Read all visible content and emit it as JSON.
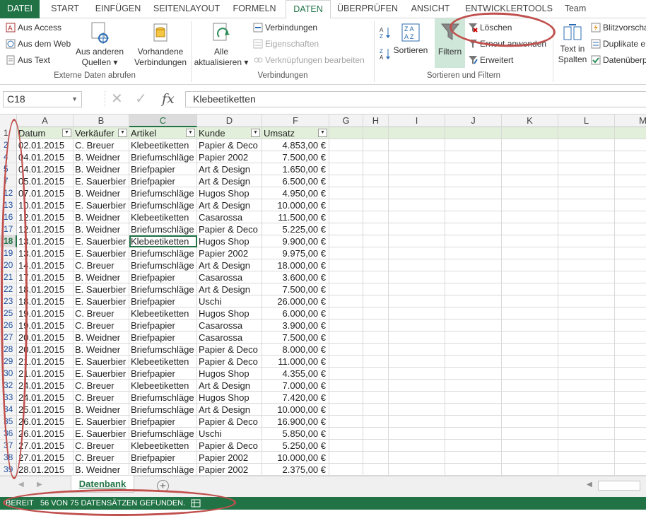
{
  "tabs": {
    "file": "DATEI",
    "start": "START",
    "insert": "EINFÜGEN",
    "pagelayout": "SEITENLAYOUT",
    "formulas": "FORMELN",
    "data": "DATEN",
    "review": "ÜBERPRÜFEN",
    "view": "ANSICHT",
    "developer": "ENTWICKLERTOOLS",
    "team": "Team"
  },
  "ribbon": {
    "ext_data": {
      "from_access": "Aus Access",
      "from_web": "Aus dem Web",
      "from_text": "Aus Text",
      "other_sources_1": "Aus anderen",
      "other_sources_2": "Quellen",
      "existing_conn_1": "Vorhandene",
      "existing_conn_2": "Verbindungen",
      "label": "Externe Daten abrufen"
    },
    "connections": {
      "refresh_1": "Alle",
      "refresh_2": "aktualisieren",
      "connections": "Verbindungen",
      "properties": "Eigenschaften",
      "edit_links": "Verknüpfungen bearbeiten",
      "label": "Verbindungen"
    },
    "sort_filter": {
      "sort": "Sortieren",
      "filter": "Filtern",
      "clear": "Löschen",
      "reapply": "Erneut anwenden",
      "advanced": "Erweitert",
      "label": "Sortieren und Filtern"
    },
    "data_tools": {
      "text_cols_1": "Text in",
      "text_cols_2": "Spalten",
      "flash_fill": "Blitzvorscha",
      "remove_dup": "Duplikate e",
      "validation": "Datenüberp"
    }
  },
  "formula_bar": {
    "name_box": "C18",
    "fx": "fx",
    "value": "Klebeetiketten"
  },
  "columns": [
    "A",
    "B",
    "C",
    "D",
    "F",
    "G",
    "H",
    "I",
    "J",
    "K",
    "L",
    "M"
  ],
  "header_row": {
    "num": "1",
    "cells": [
      "Datum",
      "Verkäufer",
      "Artikel",
      "Kunde",
      "Umsatz"
    ]
  },
  "rows": [
    {
      "num": "2",
      "cells": [
        "02.01.2015",
        "C. Breuer",
        "Klebeetiketten",
        "Papier & Deco",
        "4.853,00 €"
      ]
    },
    {
      "num": "4",
      "cells": [
        "04.01.2015",
        "B. Weidner",
        "Briefumschläge",
        "Papier 2002",
        "7.500,00 €"
      ]
    },
    {
      "num": "5",
      "cells": [
        "04.01.2015",
        "B. Weidner",
        "Briefpapier",
        "Art & Design",
        "1.650,00 €"
      ]
    },
    {
      "num": "7",
      "cells": [
        "05.01.2015",
        "E. Sauerbier",
        "Briefpapier",
        "Art & Design",
        "6.500,00 €"
      ]
    },
    {
      "num": "12",
      "cells": [
        "07.01.2015",
        "B. Weidner",
        "Briefumschläge",
        "Hugos Shop",
        "4.950,00 €"
      ]
    },
    {
      "num": "13",
      "cells": [
        "10.01.2015",
        "E. Sauerbier",
        "Briefumschläge",
        "Art & Design",
        "10.000,00 €"
      ]
    },
    {
      "num": "16",
      "cells": [
        "12.01.2015",
        "B. Weidner",
        "Klebeetiketten",
        "Casarossa",
        "11.500,00 €"
      ]
    },
    {
      "num": "17",
      "cells": [
        "12.01.2015",
        "B. Weidner",
        "Briefumschläge",
        "Papier & Deco",
        "5.225,00 €"
      ]
    },
    {
      "num": "18",
      "cells": [
        "13.01.2015",
        "E. Sauerbier",
        "Klebeetiketten",
        "Hugos Shop",
        "9.900,00 €"
      ]
    },
    {
      "num": "19",
      "cells": [
        "13.01.2015",
        "E. Sauerbier",
        "Briefumschläge",
        "Papier 2002",
        "9.975,00 €"
      ]
    },
    {
      "num": "20",
      "cells": [
        "14.01.2015",
        "C. Breuer",
        "Briefumschläge",
        "Art & Design",
        "18.000,00 €"
      ]
    },
    {
      "num": "21",
      "cells": [
        "17.01.2015",
        "B. Weidner",
        "Briefpapier",
        "Casarossa",
        "3.600,00 €"
      ]
    },
    {
      "num": "22",
      "cells": [
        "18.01.2015",
        "E. Sauerbier",
        "Briefumschläge",
        "Art & Design",
        "7.500,00 €"
      ]
    },
    {
      "num": "23",
      "cells": [
        "18.01.2015",
        "E. Sauerbier",
        "Briefpapier",
        "Uschi",
        "26.000,00 €"
      ]
    },
    {
      "num": "25",
      "cells": [
        "19.01.2015",
        "C. Breuer",
        "Klebeetiketten",
        "Hugos Shop",
        "6.000,00 €"
      ]
    },
    {
      "num": "26",
      "cells": [
        "19.01.2015",
        "C. Breuer",
        "Briefpapier",
        "Casarossa",
        "3.900,00 €"
      ]
    },
    {
      "num": "27",
      "cells": [
        "20.01.2015",
        "B. Weidner",
        "Briefpapier",
        "Casarossa",
        "7.500,00 €"
      ]
    },
    {
      "num": "28",
      "cells": [
        "20.01.2015",
        "B. Weidner",
        "Briefumschläge",
        "Papier & Deco",
        "8.000,00 €"
      ]
    },
    {
      "num": "29",
      "cells": [
        "21.01.2015",
        "E. Sauerbier",
        "Klebeetiketten",
        "Papier & Deco",
        "11.000,00 €"
      ]
    },
    {
      "num": "30",
      "cells": [
        "21.01.2015",
        "E. Sauerbier",
        "Briefpapier",
        "Hugos Shop",
        "4.355,00 €"
      ]
    },
    {
      "num": "32",
      "cells": [
        "24.01.2015",
        "C. Breuer",
        "Klebeetiketten",
        "Art & Design",
        "7.000,00 €"
      ]
    },
    {
      "num": "33",
      "cells": [
        "24.01.2015",
        "C. Breuer",
        "Briefumschläge",
        "Hugos Shop",
        "7.420,00 €"
      ]
    },
    {
      "num": "34",
      "cells": [
        "25.01.2015",
        "B. Weidner",
        "Briefumschläge",
        "Art & Design",
        "10.000,00 €"
      ]
    },
    {
      "num": "35",
      "cells": [
        "26.01.2015",
        "E. Sauerbier",
        "Briefpapier",
        "Papier & Deco",
        "16.900,00 €"
      ]
    },
    {
      "num": "36",
      "cells": [
        "26.01.2015",
        "E. Sauerbier",
        "Briefumschläge",
        "Uschi",
        "5.850,00 €"
      ]
    },
    {
      "num": "37",
      "cells": [
        "27.01.2015",
        "C. Breuer",
        "Klebeetiketten",
        "Papier & Deco",
        "5.250,00 €"
      ]
    },
    {
      "num": "38",
      "cells": [
        "27.01.2015",
        "C. Breuer",
        "Briefpapier",
        "Papier 2002",
        "10.000,00 €"
      ]
    },
    {
      "num": "39",
      "cells": [
        "28.01.2015",
        "B. Weidner",
        "Briefumschläge",
        "Papier 2002",
        "2.375,00 €"
      ]
    }
  ],
  "selected_row": "18",
  "selected_column": "C",
  "sheet_tab": "Datenbank",
  "status": {
    "ready": "BEREIT",
    "message": "56 VON 75 DATENSÄTZEN GEFUNDEN."
  },
  "colors": {
    "accent": "#217346",
    "highlight_oval": "#c0504d",
    "header_fill": "#e2efda",
    "row_num_filtered": "#1f4e9e"
  },
  "icons": [
    "access-icon",
    "web-icon",
    "text-file-icon",
    "other-sources-icon",
    "existing-connections-icon",
    "refresh-icon",
    "connections-icon",
    "properties-icon",
    "edit-links-icon",
    "sort-az-icon",
    "sort-za-icon",
    "sort-dialog-icon",
    "filter-icon",
    "clear-filter-icon",
    "reapply-icon",
    "advanced-filter-icon",
    "text-to-columns-icon",
    "flash-fill-icon",
    "remove-duplicates-icon",
    "data-validation-icon",
    "cancel-icon",
    "enter-icon",
    "filter-dropdown-icon",
    "add-sheet-icon",
    "macro-record-icon"
  ]
}
